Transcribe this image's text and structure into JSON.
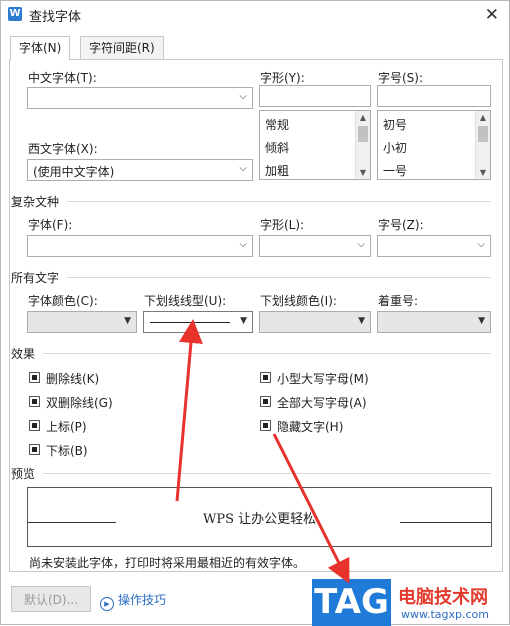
{
  "window": {
    "title": "查找字体",
    "app_icon": "W",
    "close_glyph": "✕"
  },
  "tabs": [
    "字体(N)",
    "字符间距(R)"
  ],
  "font_section": {
    "chinese_font_label": "中文字体(T):",
    "chinese_font_value": "",
    "style_label": "字形(Y):",
    "style_value": "",
    "style_options": [
      "常规",
      "倾斜",
      "加粗"
    ],
    "size_label": "字号(S):",
    "size_value": "",
    "size_options": [
      "初号",
      "小初",
      "一号"
    ],
    "western_font_label": "西文字体(X):",
    "western_font_value": "(使用中文字体)"
  },
  "complex_section": {
    "title": "复杂文种",
    "font_label": "字体(F):",
    "style_label": "字形(L):",
    "size_label": "字号(Z):"
  },
  "all_text_section": {
    "title": "所有文字",
    "font_color_label": "字体颜色(C):",
    "underline_type_label": "下划线线型(U):",
    "underline_color_label": "下划线颜色(I):",
    "emphasis_label": "着重号:"
  },
  "effects_section": {
    "title": "效果",
    "left": [
      "删除线(K)",
      "双删除线(G)",
      "上标(P)",
      "下标(B)"
    ],
    "right": [
      "小型大写字母(M)",
      "全部大写字母(A)",
      "隐藏文字(H)"
    ]
  },
  "preview_section": {
    "title": "预览",
    "sample_text": "WPS 让办公更轻松",
    "note": "尚未安装此字体，打印时将采用最相近的有效字体。"
  },
  "buttons": {
    "default_label": "默认(D)...",
    "tips_label": "操作技巧"
  },
  "watermark": {
    "tag": "TAG",
    "site_name": "电脑技术网",
    "url": "www.tagxp.com"
  },
  "colors": {
    "accent": "#2b6cc4",
    "arrow": "#e8322c",
    "tag_bg": "#1f7ad8"
  }
}
